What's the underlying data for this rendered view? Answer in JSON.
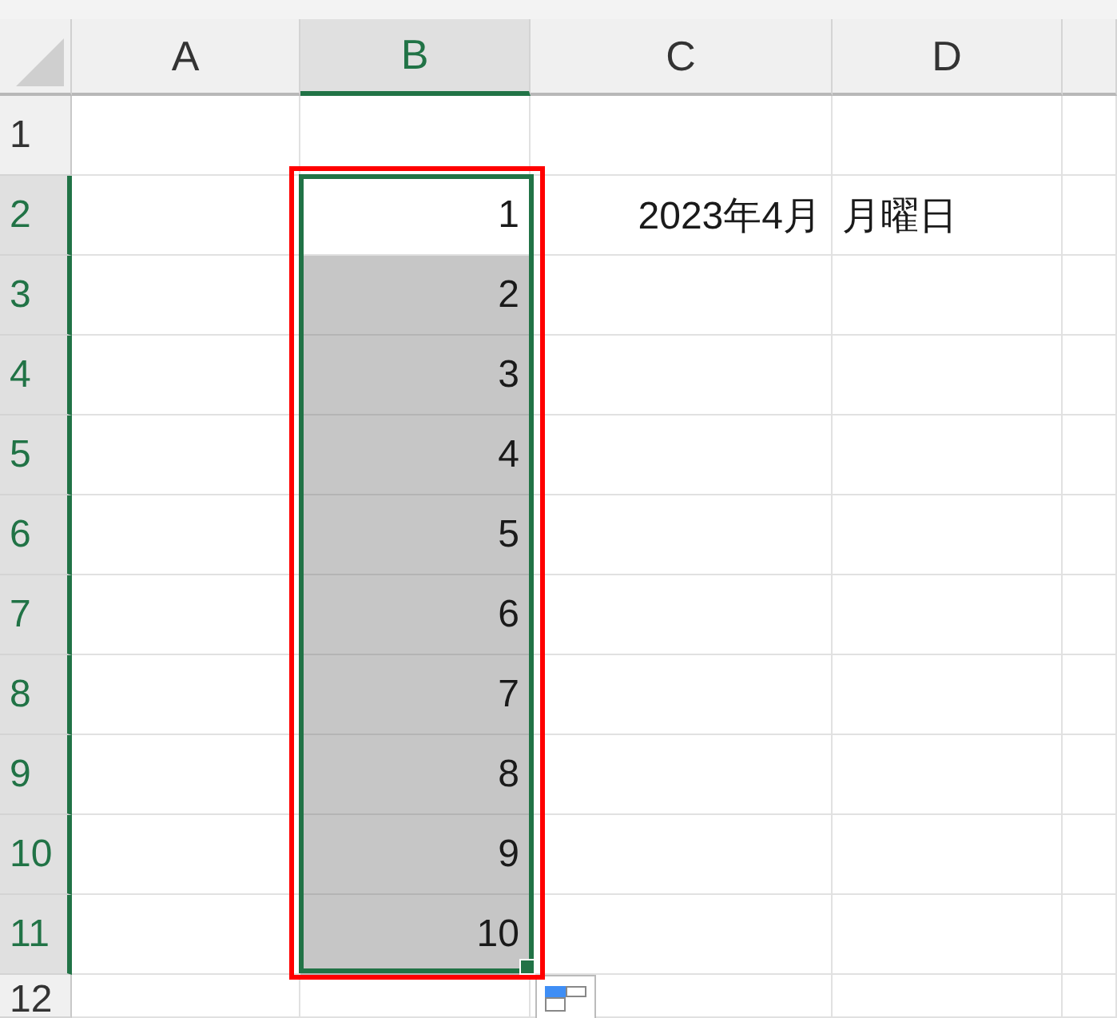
{
  "columns": [
    {
      "label": "A",
      "selected": false
    },
    {
      "label": "B",
      "selected": true
    },
    {
      "label": "C",
      "selected": false
    },
    {
      "label": "D",
      "selected": false
    }
  ],
  "rows": [
    {
      "label": "1",
      "selected": false,
      "cells": [
        {
          "selected": false,
          "active": false
        },
        {
          "selected": false,
          "active": false
        },
        {
          "selected": false,
          "active": false
        },
        {
          "selected": false,
          "active": false
        }
      ]
    },
    {
      "label": "2",
      "selected": true,
      "cells": [
        {
          "selected": false,
          "active": false
        },
        {
          "selected": true,
          "active": true,
          "kind": "number",
          "value": "1"
        },
        {
          "selected": false,
          "active": false,
          "kind": "number",
          "value": "2023年4月"
        },
        {
          "selected": false,
          "active": false,
          "kind": "text",
          "value": "月曜日"
        }
      ]
    },
    {
      "label": "3",
      "selected": true,
      "cells": [
        {
          "selected": false,
          "active": false
        },
        {
          "selected": true,
          "active": false,
          "kind": "number",
          "value": "2"
        },
        {
          "selected": false,
          "active": false
        },
        {
          "selected": false,
          "active": false
        }
      ]
    },
    {
      "label": "4",
      "selected": true,
      "cells": [
        {
          "selected": false,
          "active": false
        },
        {
          "selected": true,
          "active": false,
          "kind": "number",
          "value": "3"
        },
        {
          "selected": false,
          "active": false
        },
        {
          "selected": false,
          "active": false
        }
      ]
    },
    {
      "label": "5",
      "selected": true,
      "cells": [
        {
          "selected": false,
          "active": false
        },
        {
          "selected": true,
          "active": false,
          "kind": "number",
          "value": "4"
        },
        {
          "selected": false,
          "active": false
        },
        {
          "selected": false,
          "active": false
        }
      ]
    },
    {
      "label": "6",
      "selected": true,
      "cells": [
        {
          "selected": false,
          "active": false
        },
        {
          "selected": true,
          "active": false,
          "kind": "number",
          "value": "5"
        },
        {
          "selected": false,
          "active": false
        },
        {
          "selected": false,
          "active": false
        }
      ]
    },
    {
      "label": "7",
      "selected": true,
      "cells": [
        {
          "selected": false,
          "active": false
        },
        {
          "selected": true,
          "active": false,
          "kind": "number",
          "value": "6"
        },
        {
          "selected": false,
          "active": false
        },
        {
          "selected": false,
          "active": false
        }
      ]
    },
    {
      "label": "8",
      "selected": true,
      "cells": [
        {
          "selected": false,
          "active": false
        },
        {
          "selected": true,
          "active": false,
          "kind": "number",
          "value": "7"
        },
        {
          "selected": false,
          "active": false
        },
        {
          "selected": false,
          "active": false
        }
      ]
    },
    {
      "label": "9",
      "selected": true,
      "cells": [
        {
          "selected": false,
          "active": false
        },
        {
          "selected": true,
          "active": false,
          "kind": "number",
          "value": "8"
        },
        {
          "selected": false,
          "active": false
        },
        {
          "selected": false,
          "active": false
        }
      ]
    },
    {
      "label": "10",
      "selected": true,
      "cells": [
        {
          "selected": false,
          "active": false
        },
        {
          "selected": true,
          "active": false,
          "kind": "number",
          "value": "9"
        },
        {
          "selected": false,
          "active": false
        },
        {
          "selected": false,
          "active": false
        }
      ]
    },
    {
      "label": "11",
      "selected": true,
      "cells": [
        {
          "selected": false,
          "active": false
        },
        {
          "selected": true,
          "active": false,
          "kind": "number",
          "value": "10"
        },
        {
          "selected": false,
          "active": false
        },
        {
          "selected": false,
          "active": false
        }
      ]
    },
    {
      "label": "12",
      "selected": false,
      "cells": [
        {
          "selected": false,
          "active": false
        },
        {
          "selected": false,
          "active": false
        },
        {
          "selected": false,
          "active": false
        },
        {
          "selected": false,
          "active": false
        }
      ]
    }
  ],
  "selection": {
    "fill_handle": true,
    "quick_analysis_button": true
  },
  "annotation": {
    "kind": "rectangle"
  }
}
